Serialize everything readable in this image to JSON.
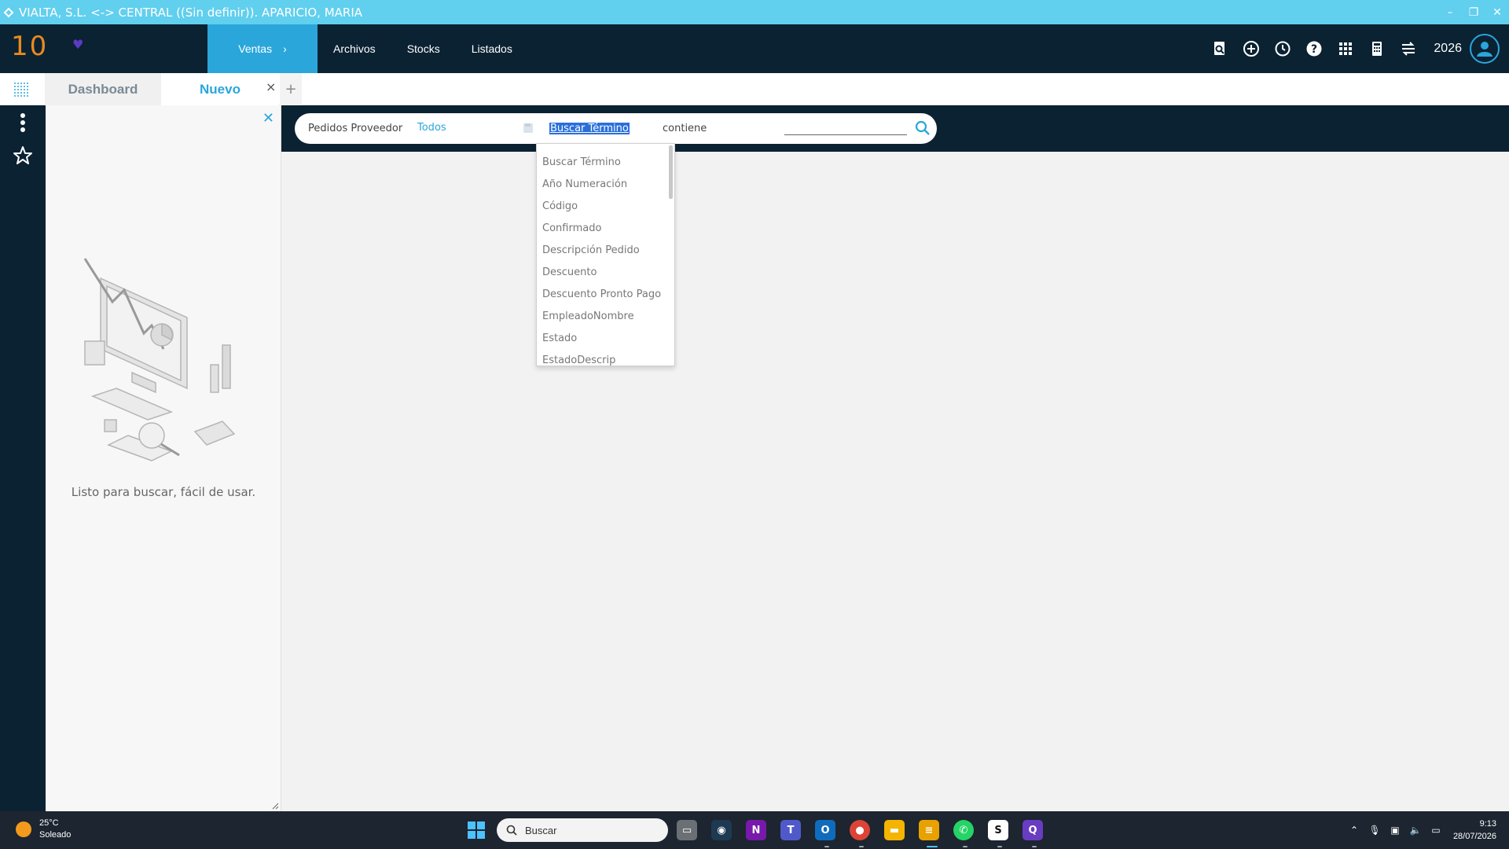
{
  "window": {
    "title": "VIALTA, S.L. <-> CENTRAL ((Sin definir)). APARICIO, MARIA",
    "minimize": "–",
    "restore": "❐",
    "close": "✕"
  },
  "logo": {
    "number": "10",
    "heart": "♥"
  },
  "nav": {
    "active": "Ventas",
    "items": [
      "Archivos",
      "Stocks",
      "Listados"
    ]
  },
  "header": {
    "year": "2026"
  },
  "tabs": {
    "dashboard": "Dashboard",
    "nuevo": "Nuevo",
    "close": "×",
    "add": "+"
  },
  "left_panel": {
    "close": "✕",
    "message": "Listo para buscar, fácil de usar."
  },
  "search": {
    "entity": "Pedidos Proveedor",
    "scope": "Todos",
    "field": "Buscar Término",
    "operator": "contiene",
    "value": "",
    "placeholder": ""
  },
  "dropdown": {
    "options": [
      "Buscar Término",
      "Año Numeración",
      "Código",
      "Confirmado",
      "Descripción Pedido",
      "Descuento",
      "Descuento Pronto Pago",
      "EmpleadoNombre",
      "Estado",
      "EstadoDescrip"
    ]
  },
  "taskbar": {
    "temperature": "25°C",
    "weather": "Soleado",
    "search": "Buscar",
    "time": "9:13",
    "date": "28/07/2026",
    "apps": [
      "file-explorer-icon",
      "security-icon",
      "onenote-icon",
      "teams-icon",
      "outlook-icon",
      "chrome-icon",
      "folder-icon",
      "notes-icon",
      "whatsapp-icon",
      "s-app-icon",
      "q-app-icon"
    ]
  },
  "colors": {
    "titlebar": "#61cfee",
    "nav_bg": "#0b2233",
    "accent": "#2aa6db",
    "selection": "#2a6fd9",
    "taskbar": "#1c2530"
  }
}
